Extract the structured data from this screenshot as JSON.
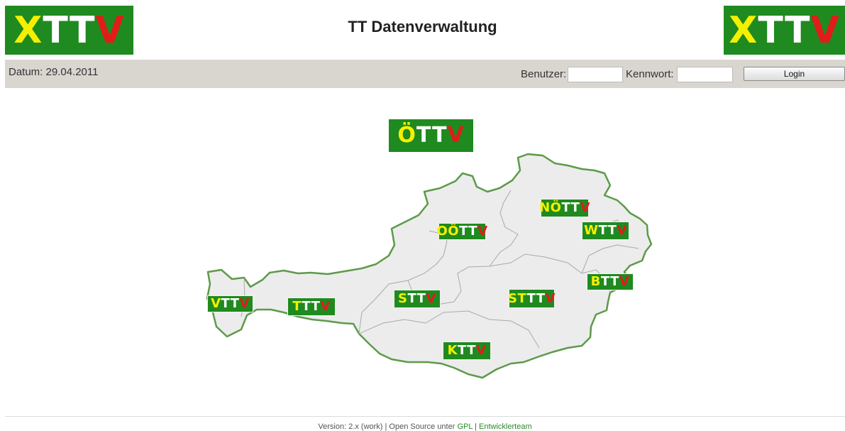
{
  "header": {
    "title": "TT Datenverwaltung",
    "logo_left": {
      "p1": "X",
      "p2": "TT",
      "p3": "V"
    },
    "logo_right": {
      "p1": "X",
      "p2": "TT",
      "p3": "V"
    }
  },
  "toolbar": {
    "date_text": "Datum: 29.04.2011",
    "user_label": "Benutzer:",
    "user_value": "",
    "password_label": "Kennwort:",
    "password_value": "",
    "login_label": "Login"
  },
  "main": {
    "oettv_logo": {
      "p1": "Ö",
      "p2": "TT",
      "p3": "V"
    },
    "states": [
      {
        "key": "vttv",
        "p1": "V",
        "p2": "TT",
        "p3": "V"
      },
      {
        "key": "tttv",
        "p1": "T",
        "p2": "TT",
        "p3": "V"
      },
      {
        "key": "sttv",
        "p1": "S",
        "p2": "TT",
        "p3": "V"
      },
      {
        "key": "ooettv",
        "p1": "OÖ",
        "p2": "TT",
        "p3": "V"
      },
      {
        "key": "noettv",
        "p1": "NÖ",
        "p2": "TT",
        "p3": "V"
      },
      {
        "key": "wttv",
        "p1": "W",
        "p2": "TT",
        "p3": "V"
      },
      {
        "key": "bttv",
        "p1": "B",
        "p2": "TT",
        "p3": "V"
      },
      {
        "key": "stttv",
        "p1": "ST",
        "p2": "TT",
        "p3": "V"
      },
      {
        "key": "kttv",
        "p1": "K",
        "p2": "TT",
        "p3": "V"
      }
    ]
  },
  "footer": {
    "version_text": "Version: 2.x (work) | Open Source unter ",
    "gpl_link": "GPL",
    "separator": " | ",
    "team_link": "Entwicklerteam"
  },
  "colors": {
    "logo_green": "#1f8a1f",
    "logo_yellow": "#f4f000",
    "logo_red": "#e21b1b",
    "map_fill": "#ececec",
    "map_border": "#5d9a4a",
    "bar_bg": "#d9d6d0",
    "link": "#2b8a2b"
  }
}
